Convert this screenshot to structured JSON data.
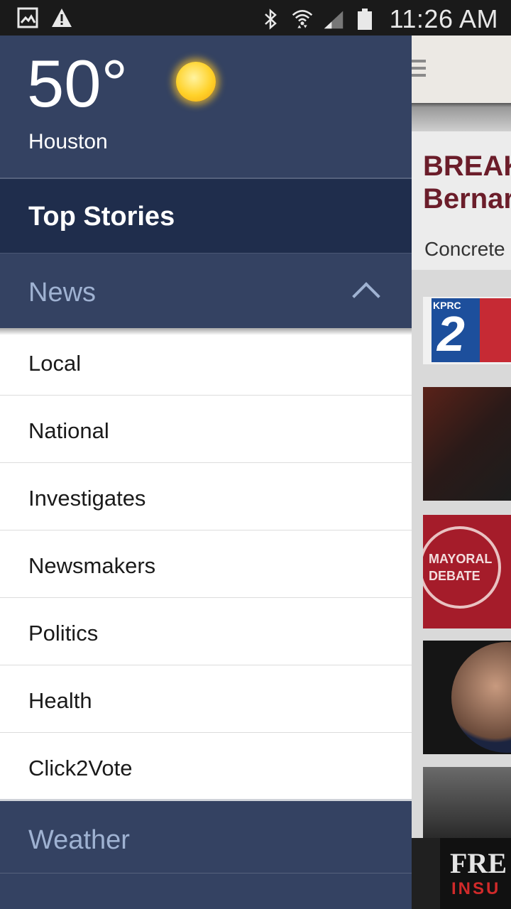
{
  "status_bar": {
    "time": "11:26 AM",
    "icons_left": [
      "gallery-icon",
      "warning-icon"
    ],
    "icons_right": [
      "bluetooth-icon",
      "wifi-icon",
      "signal-icon",
      "battery-icon"
    ]
  },
  "drawer": {
    "weather": {
      "temperature": "50°",
      "city": "Houston",
      "condition_icon": "sun-icon"
    },
    "top_item": {
      "label": "Top Stories"
    },
    "news_section": {
      "label": "News",
      "expanded": true,
      "items": [
        {
          "label": "Local"
        },
        {
          "label": "National"
        },
        {
          "label": "Investigates"
        },
        {
          "label": "Newsmakers"
        },
        {
          "label": "Politics"
        },
        {
          "label": "Health"
        },
        {
          "label": "Click2Vote"
        }
      ]
    },
    "weather_section": {
      "label": "Weather"
    }
  },
  "background": {
    "headline": [
      "BREAK",
      "Bernar"
    ],
    "subtitle": "Concrete",
    "kprc_logo_text": "KPRC",
    "debate_text": [
      "MAYORAL",
      "DEBATE"
    ],
    "ad_text": [
      "FRE",
      "INSU"
    ]
  },
  "colors": {
    "drawer_bg": "#344262",
    "top_item_bg": "#1f2d4c",
    "section_label": "#9fb2d2",
    "headline": "#6b1d2a"
  }
}
